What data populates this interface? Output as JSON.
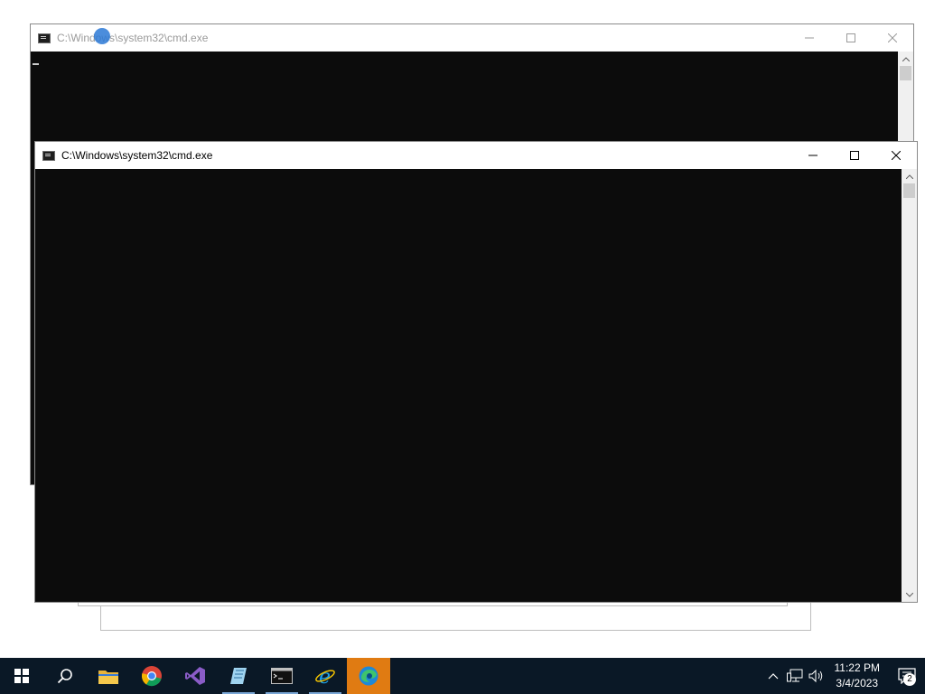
{
  "windows": [
    {
      "id": "back",
      "title": "C:\\Windows\\system32\\cmd.exe",
      "state": "inactive"
    },
    {
      "id": "front",
      "title": "C:\\Windows\\system32\\cmd.exe",
      "state": "active"
    }
  ],
  "taskbar": {
    "apps": [
      {
        "name": "start",
        "icon": "windows-logo-icon"
      },
      {
        "name": "search",
        "icon": "search-icon"
      },
      {
        "name": "file-explorer",
        "icon": "folder-icon"
      },
      {
        "name": "chrome",
        "icon": "chrome-icon"
      },
      {
        "name": "visual-studio",
        "icon": "visual-studio-icon"
      },
      {
        "name": "notepad",
        "icon": "notepad-icon",
        "running": true
      },
      {
        "name": "cmd",
        "icon": "cmd-icon",
        "running": true
      },
      {
        "name": "internet-explorer",
        "icon": "ie-icon",
        "running": true
      },
      {
        "name": "edge",
        "icon": "edge-icon",
        "active": true
      }
    ],
    "clock": {
      "time": "11:22 PM",
      "date": "3/4/2023"
    },
    "notifications": {
      "count": "2"
    }
  },
  "colors": {
    "taskbar": "#0a1826",
    "console": "#0c0c0c",
    "active_app": "#e07b12"
  }
}
